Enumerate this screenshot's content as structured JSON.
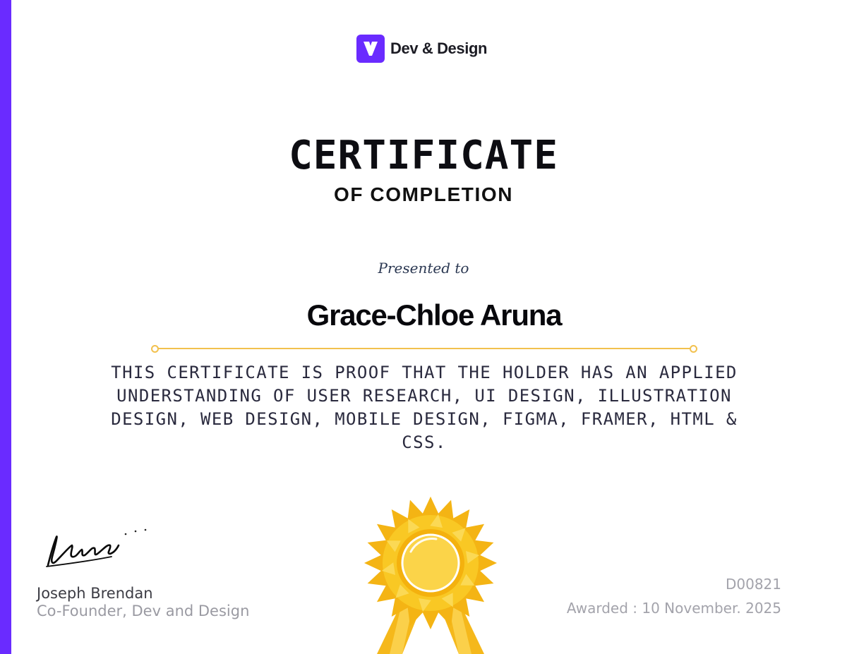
{
  "theme": {
    "accent": "#6a2bff",
    "gold": "#f2c14e"
  },
  "brand": {
    "name": "Dev & Design",
    "logo_icon": "v-logo-icon"
  },
  "certificate": {
    "title": "CERTIFICATE",
    "subtitle": "OF COMPLETION",
    "presented_label": "Presented to",
    "recipient": "Grace-Chloe Aruna",
    "statement": "THIS CERTIFICATE IS PROOF THAT THE HOLDER HAS AN APPLIED UNDERSTANDING OF USER RESEARCH, UI DESIGN, ILLUSTRATION DESIGN, WEB DESIGN, MOBILE DESIGN, FIGMA, FRAMER, HTML & CSS.",
    "id": "D00821",
    "awarded": "Awarded : 10 November. 2025"
  },
  "signatory": {
    "name": "Joseph Brendan",
    "role": "Co-Founder, Dev and Design",
    "signature_icon": "handwritten-signature"
  },
  "badge": {
    "icon": "award-ribbon-icon"
  }
}
